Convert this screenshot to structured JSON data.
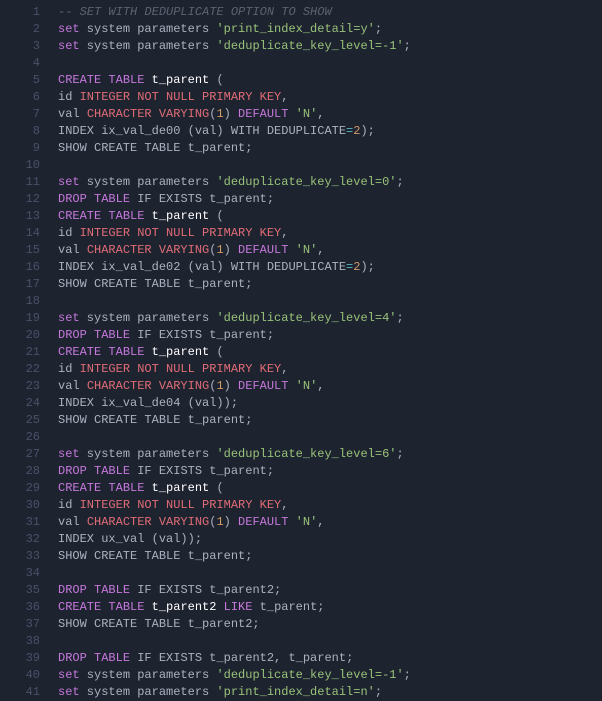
{
  "lines": {
    "l1": {
      "n": "1",
      "t": [
        {
          "c": "cmt",
          "v": "-- SET WITH DEDUPLICATE OPTION TO SHOW"
        }
      ]
    },
    "l2": {
      "n": "2",
      "t": [
        {
          "c": "kw",
          "v": "set"
        },
        {
          "c": "id",
          "v": " system parameters "
        },
        {
          "c": "str",
          "v": "'print_index_detail=y'"
        },
        {
          "c": "pn",
          "v": ";"
        }
      ]
    },
    "l3": {
      "n": "3",
      "t": [
        {
          "c": "kw",
          "v": "set"
        },
        {
          "c": "id",
          "v": " system parameters "
        },
        {
          "c": "str",
          "v": "'deduplicate_key_level=-1'"
        },
        {
          "c": "pn",
          "v": ";"
        }
      ]
    },
    "l4": {
      "n": "4",
      "t": []
    },
    "l5": {
      "n": "5",
      "t": [
        {
          "c": "kw",
          "v": "CREATE"
        },
        {
          "c": "id",
          "v": " "
        },
        {
          "c": "kw",
          "v": "TABLE"
        },
        {
          "c": "id",
          "v": " "
        },
        {
          "c": "tbl",
          "v": "t_parent"
        },
        {
          "c": "id",
          "v": " ("
        }
      ]
    },
    "l6": {
      "n": "6",
      "t": [
        {
          "c": "id",
          "v": "id "
        },
        {
          "c": "typ",
          "v": "INTEGER NOT NULL PRIMARY KEY"
        },
        {
          "c": "pn",
          "v": ","
        }
      ]
    },
    "l7": {
      "n": "7",
      "t": [
        {
          "c": "id",
          "v": "val "
        },
        {
          "c": "typ",
          "v": "CHARACTER VARYING"
        },
        {
          "c": "pn",
          "v": "("
        },
        {
          "c": "num",
          "v": "1"
        },
        {
          "c": "pn",
          "v": ") "
        },
        {
          "c": "kw",
          "v": "DEFAULT"
        },
        {
          "c": "id",
          "v": " "
        },
        {
          "c": "str",
          "v": "'N'"
        },
        {
          "c": "pn",
          "v": ","
        }
      ]
    },
    "l8": {
      "n": "8",
      "t": [
        {
          "c": "id",
          "v": "INDEX ix_val_de00 (val) WITH DEDUPLICATE"
        },
        {
          "c": "op",
          "v": "="
        },
        {
          "c": "num",
          "v": "2"
        },
        {
          "c": "pn",
          "v": ");"
        }
      ]
    },
    "l9": {
      "n": "9",
      "t": [
        {
          "c": "id",
          "v": "SHOW CREATE TABLE t_parent;"
        }
      ]
    },
    "l10": {
      "n": "10",
      "t": []
    },
    "l11": {
      "n": "11",
      "t": [
        {
          "c": "kw",
          "v": "set"
        },
        {
          "c": "id",
          "v": " system parameters "
        },
        {
          "c": "str",
          "v": "'deduplicate_key_level=0'"
        },
        {
          "c": "pn",
          "v": ";"
        }
      ]
    },
    "l12": {
      "n": "12",
      "t": [
        {
          "c": "kw",
          "v": "DROP"
        },
        {
          "c": "id",
          "v": " "
        },
        {
          "c": "kw",
          "v": "TABLE"
        },
        {
          "c": "id",
          "v": " IF EXISTS t_parent;"
        }
      ]
    },
    "l13": {
      "n": "13",
      "t": [
        {
          "c": "kw",
          "v": "CREATE"
        },
        {
          "c": "id",
          "v": " "
        },
        {
          "c": "kw",
          "v": "TABLE"
        },
        {
          "c": "id",
          "v": " "
        },
        {
          "c": "tbl",
          "v": "t_parent"
        },
        {
          "c": "id",
          "v": " ("
        }
      ]
    },
    "l14": {
      "n": "14",
      "t": [
        {
          "c": "id",
          "v": "id "
        },
        {
          "c": "typ",
          "v": "INTEGER NOT NULL PRIMARY KEY"
        },
        {
          "c": "pn",
          "v": ","
        }
      ]
    },
    "l15": {
      "n": "15",
      "t": [
        {
          "c": "id",
          "v": "val "
        },
        {
          "c": "typ",
          "v": "CHARACTER VARYING"
        },
        {
          "c": "pn",
          "v": "("
        },
        {
          "c": "num",
          "v": "1"
        },
        {
          "c": "pn",
          "v": ") "
        },
        {
          "c": "kw",
          "v": "DEFAULT"
        },
        {
          "c": "id",
          "v": " "
        },
        {
          "c": "str",
          "v": "'N'"
        },
        {
          "c": "pn",
          "v": ","
        }
      ]
    },
    "l16": {
      "n": "16",
      "t": [
        {
          "c": "id",
          "v": "INDEX ix_val_de02 (val) WITH DEDUPLICATE"
        },
        {
          "c": "op",
          "v": "="
        },
        {
          "c": "num",
          "v": "2"
        },
        {
          "c": "pn",
          "v": ");"
        }
      ]
    },
    "l17": {
      "n": "17",
      "t": [
        {
          "c": "id",
          "v": "SHOW CREATE TABLE t_parent;"
        }
      ]
    },
    "l18": {
      "n": "18",
      "t": []
    },
    "l19": {
      "n": "19",
      "t": [
        {
          "c": "kw",
          "v": "set"
        },
        {
          "c": "id",
          "v": " system parameters "
        },
        {
          "c": "str",
          "v": "'deduplicate_key_level=4'"
        },
        {
          "c": "pn",
          "v": ";"
        }
      ]
    },
    "l20": {
      "n": "20",
      "t": [
        {
          "c": "kw",
          "v": "DROP"
        },
        {
          "c": "id",
          "v": " "
        },
        {
          "c": "kw",
          "v": "TABLE"
        },
        {
          "c": "id",
          "v": " IF EXISTS t_parent;"
        }
      ]
    },
    "l21": {
      "n": "21",
      "t": [
        {
          "c": "kw",
          "v": "CREATE"
        },
        {
          "c": "id",
          "v": " "
        },
        {
          "c": "kw",
          "v": "TABLE"
        },
        {
          "c": "id",
          "v": " "
        },
        {
          "c": "tbl",
          "v": "t_parent"
        },
        {
          "c": "id",
          "v": " ("
        }
      ]
    },
    "l22": {
      "n": "22",
      "t": [
        {
          "c": "id",
          "v": "id "
        },
        {
          "c": "typ",
          "v": "INTEGER NOT NULL PRIMARY KEY"
        },
        {
          "c": "pn",
          "v": ","
        }
      ]
    },
    "l23": {
      "n": "23",
      "t": [
        {
          "c": "id",
          "v": "val "
        },
        {
          "c": "typ",
          "v": "CHARACTER VARYING"
        },
        {
          "c": "pn",
          "v": "("
        },
        {
          "c": "num",
          "v": "1"
        },
        {
          "c": "pn",
          "v": ") "
        },
        {
          "c": "kw",
          "v": "DEFAULT"
        },
        {
          "c": "id",
          "v": " "
        },
        {
          "c": "str",
          "v": "'N'"
        },
        {
          "c": "pn",
          "v": ","
        }
      ]
    },
    "l24": {
      "n": "24",
      "t": [
        {
          "c": "id",
          "v": "INDEX ix_val_de04 (val));"
        }
      ]
    },
    "l25": {
      "n": "25",
      "t": [
        {
          "c": "id",
          "v": "SHOW CREATE TABLE t_parent;"
        }
      ]
    },
    "l26": {
      "n": "26",
      "t": []
    },
    "l27": {
      "n": "27",
      "t": [
        {
          "c": "kw",
          "v": "set"
        },
        {
          "c": "id",
          "v": " system parameters "
        },
        {
          "c": "str",
          "v": "'deduplicate_key_level=6'"
        },
        {
          "c": "pn",
          "v": ";"
        }
      ]
    },
    "l28": {
      "n": "28",
      "t": [
        {
          "c": "kw",
          "v": "DROP"
        },
        {
          "c": "id",
          "v": " "
        },
        {
          "c": "kw",
          "v": "TABLE"
        },
        {
          "c": "id",
          "v": " IF EXISTS t_parent;"
        }
      ]
    },
    "l29": {
      "n": "29",
      "t": [
        {
          "c": "kw",
          "v": "CREATE"
        },
        {
          "c": "id",
          "v": " "
        },
        {
          "c": "kw",
          "v": "TABLE"
        },
        {
          "c": "id",
          "v": " "
        },
        {
          "c": "tbl",
          "v": "t_parent"
        },
        {
          "c": "id",
          "v": " ("
        }
      ]
    },
    "l30": {
      "n": "30",
      "t": [
        {
          "c": "id",
          "v": "id "
        },
        {
          "c": "typ",
          "v": "INTEGER NOT NULL PRIMARY KEY"
        },
        {
          "c": "pn",
          "v": ","
        }
      ]
    },
    "l31": {
      "n": "31",
      "t": [
        {
          "c": "id",
          "v": "val "
        },
        {
          "c": "typ",
          "v": "CHARACTER VARYING"
        },
        {
          "c": "pn",
          "v": "("
        },
        {
          "c": "num",
          "v": "1"
        },
        {
          "c": "pn",
          "v": ") "
        },
        {
          "c": "kw",
          "v": "DEFAULT"
        },
        {
          "c": "id",
          "v": " "
        },
        {
          "c": "str",
          "v": "'N'"
        },
        {
          "c": "pn",
          "v": ","
        }
      ]
    },
    "l32": {
      "n": "32",
      "t": [
        {
          "c": "id",
          "v": "INDEX ux_val (val));"
        }
      ]
    },
    "l33": {
      "n": "33",
      "t": [
        {
          "c": "id",
          "v": "SHOW CREATE TABLE t_parent;"
        }
      ]
    },
    "l34": {
      "n": "34",
      "t": []
    },
    "l35": {
      "n": "35",
      "t": [
        {
          "c": "kw",
          "v": "DROP"
        },
        {
          "c": "id",
          "v": " "
        },
        {
          "c": "kw",
          "v": "TABLE"
        },
        {
          "c": "id",
          "v": " IF EXISTS t_parent2;"
        }
      ]
    },
    "l36": {
      "n": "36",
      "t": [
        {
          "c": "kw",
          "v": "CREATE"
        },
        {
          "c": "id",
          "v": " "
        },
        {
          "c": "kw",
          "v": "TABLE"
        },
        {
          "c": "id",
          "v": " "
        },
        {
          "c": "tbl",
          "v": "t_parent2"
        },
        {
          "c": "id",
          "v": " "
        },
        {
          "c": "kw",
          "v": "LIKE"
        },
        {
          "c": "id",
          "v": " t_parent;"
        }
      ]
    },
    "l37": {
      "n": "37",
      "t": [
        {
          "c": "id",
          "v": "SHOW CREATE TABLE t_parent2;"
        }
      ]
    },
    "l38": {
      "n": "38",
      "t": []
    },
    "l39": {
      "n": "39",
      "t": [
        {
          "c": "kw",
          "v": "DROP"
        },
        {
          "c": "id",
          "v": " "
        },
        {
          "c": "kw",
          "v": "TABLE"
        },
        {
          "c": "id",
          "v": " IF EXISTS t_parent2, t_parent;"
        }
      ]
    },
    "l40": {
      "n": "40",
      "t": [
        {
          "c": "kw",
          "v": "set"
        },
        {
          "c": "id",
          "v": " system parameters "
        },
        {
          "c": "str",
          "v": "'deduplicate_key_level=-1'"
        },
        {
          "c": "pn",
          "v": ";"
        }
      ]
    },
    "l41": {
      "n": "41",
      "t": [
        {
          "c": "kw",
          "v": "set"
        },
        {
          "c": "id",
          "v": " system parameters "
        },
        {
          "c": "str",
          "v": "'print_index_detail=n'"
        },
        {
          "c": "pn",
          "v": ";"
        }
      ]
    }
  },
  "order": [
    "l1",
    "l2",
    "l3",
    "l4",
    "l5",
    "l6",
    "l7",
    "l8",
    "l9",
    "l10",
    "l11",
    "l12",
    "l13",
    "l14",
    "l15",
    "l16",
    "l17",
    "l18",
    "l19",
    "l20",
    "l21",
    "l22",
    "l23",
    "l24",
    "l25",
    "l26",
    "l27",
    "l28",
    "l29",
    "l30",
    "l31",
    "l32",
    "l33",
    "l34",
    "l35",
    "l36",
    "l37",
    "l38",
    "l39",
    "l40",
    "l41"
  ]
}
